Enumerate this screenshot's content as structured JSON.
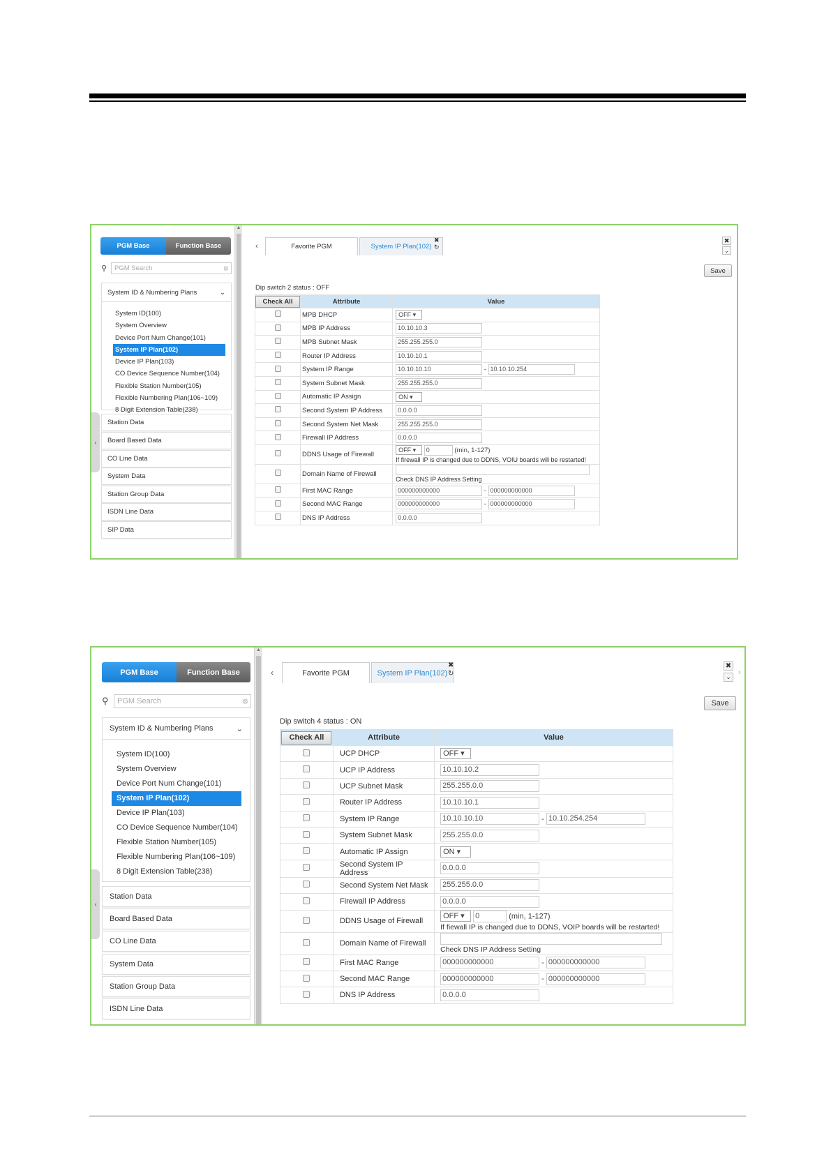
{
  "shots": [
    {
      "tabs": {
        "pgm_base": "PGM Base",
        "function_base": "Function Base"
      },
      "search": {
        "placeholder": "PGM Search"
      },
      "menu": {
        "group_title": "System ID & Numbering Plans",
        "items": [
          "System ID(100)",
          "System Overview",
          "Device Port Num Change(101)",
          "System IP Plan(102)",
          "Device IP Plan(103)",
          "CO Device Sequence Number(104)",
          "Flexible Station Number(105)",
          "Flexible Numbering Plan(106~109)",
          "8 Digit Extension Table(238)"
        ],
        "categories": [
          "Station Data",
          "Board Based Data",
          "CO Line Data",
          "System Data",
          "Station Group Data",
          "ISDN Line Data",
          "SIP Data"
        ]
      },
      "content_tabs": {
        "favorite": "Favorite PGM",
        "active": "System IP Plan(102)"
      },
      "save_label": "Save",
      "dip_status": "Dip switch 2 status : OFF",
      "table": {
        "check_all": "Check All",
        "attr_header": "Attribute",
        "value_header": "Value",
        "rows": [
          {
            "attr": "MPB DHCP",
            "select": "OFF"
          },
          {
            "attr": "MPB IP Address",
            "v1": "10.10.10.3"
          },
          {
            "attr": "MPB Subnet Mask",
            "v1": "255.255.255.0"
          },
          {
            "attr": "Router IP Address",
            "v1": "10.10.10.1"
          },
          {
            "attr": "System IP Range",
            "v1": "10.10.10.10",
            "v2": "10.10.10.254"
          },
          {
            "attr": "System Subnet Mask",
            "v1": "255.255.255.0"
          },
          {
            "attr": "Automatic IP Assign",
            "select": "ON"
          },
          {
            "attr": "Second System IP Address",
            "v1": "0.0.0.0"
          },
          {
            "attr": "Second System Net Mask",
            "v1": "255.255.255.0"
          },
          {
            "attr": "Firewall IP Address",
            "v1": "0.0.0.0"
          },
          {
            "attr": "DDNS Usage of Firewall",
            "select": "OFF",
            "v1": "0",
            "hint": "(min, 1-127)",
            "note": "If firewall IP is changed due to DDNS, VOIU boards will be restarted!"
          },
          {
            "attr": "Domain Name of Firewall",
            "v1": "",
            "note": "Check DNS IP Address Setting"
          },
          {
            "attr": "First MAC Range",
            "v1": "000000000000",
            "v2": "000000000000"
          },
          {
            "attr": "Second MAC Range",
            "v1": "000000000000",
            "v2": "000000000000"
          },
          {
            "attr": "DNS IP Address",
            "v1": "0.0.0.0"
          }
        ]
      }
    },
    {
      "tabs": {
        "pgm_base": "PGM Base",
        "function_base": "Function Base"
      },
      "search": {
        "placeholder": "PGM Search"
      },
      "menu": {
        "group_title": "System ID & Numbering Plans",
        "items": [
          "System ID(100)",
          "System Overview",
          "Device Port Num Change(101)",
          "System IP Plan(102)",
          "Device IP Plan(103)",
          "CO Device Sequence Number(104)",
          "Flexible Station Number(105)",
          "Flexible Numbering Plan(106~109)",
          "8 Digit Extension Table(238)"
        ],
        "categories": [
          "Station Data",
          "Board Based Data",
          "CO Line Data",
          "System Data",
          "Station Group Data",
          "ISDN Line Data"
        ]
      },
      "content_tabs": {
        "favorite": "Favorite PGM",
        "active": "System IP Plan(102)"
      },
      "save_label": "Save",
      "dip_status": "Dip switch 4 status : ON",
      "table": {
        "check_all": "Check All",
        "attr_header": "Attribute",
        "value_header": "Value",
        "rows": [
          {
            "attr": "UCP DHCP",
            "select": "OFF"
          },
          {
            "attr": "UCP IP Address",
            "v1": "10.10.10.2"
          },
          {
            "attr": "UCP Subnet Mask",
            "v1": "255.255.0.0"
          },
          {
            "attr": "Router IP Address",
            "v1": "10.10.10.1"
          },
          {
            "attr": "System IP Range",
            "v1": "10.10.10.10",
            "v2": "10.10.254.254"
          },
          {
            "attr": "System Subnet Mask",
            "v1": "255.255.0.0"
          },
          {
            "attr": "Automatic IP Assign",
            "select": "ON"
          },
          {
            "attr": "Second System IP Address",
            "v1": "0.0.0.0"
          },
          {
            "attr": "Second System Net Mask",
            "v1": "255.255.0.0"
          },
          {
            "attr": "Firewall IP Address",
            "v1": "0.0.0.0"
          },
          {
            "attr": "DDNS Usage of Firewall",
            "select": "OFF",
            "v1": "0",
            "hint": "(min, 1-127)",
            "note": "If fiewall IP is changed due to DDNS, VOIP boards will be restarted!"
          },
          {
            "attr": "Domain Name of Firewall",
            "v1": "",
            "note": "Check DNS IP Address Setting"
          },
          {
            "attr": "First MAC Range",
            "v1": "000000000000",
            "v2": "000000000000"
          },
          {
            "attr": "Second MAC Range",
            "v1": "000000000000",
            "v2": "000000000000"
          },
          {
            "attr": "DNS IP Address",
            "v1": "0.0.0.0"
          }
        ]
      }
    }
  ],
  "icons": {
    "search": "search-icon",
    "clear": "clear-icon",
    "chevron_down": "chevron-down-icon",
    "chevron_left": "chevron-left-icon",
    "close": "close-icon",
    "refresh": "refresh-icon",
    "dropdown_arrow": "dropdown-arrow-icon"
  },
  "colors": {
    "frame_border": "#8ed16a",
    "active_blue": "#1e88e5",
    "header_blue": "#cfe5f5",
    "tab_text_blue": "#2a8ad6"
  }
}
